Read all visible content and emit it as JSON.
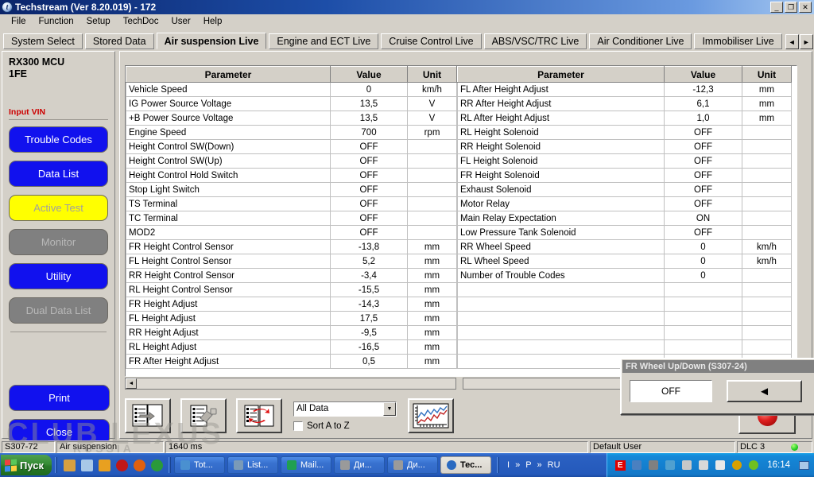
{
  "window": {
    "title": "Techstream (Ver 8.20.019) - 172",
    "icon": "techstream-logo-icon",
    "minimize": "_",
    "restore": "❐",
    "close": "✕"
  },
  "menubar": {
    "items": [
      "File",
      "Function",
      "Setup",
      "TechDoc",
      "User",
      "Help"
    ]
  },
  "tabs": {
    "items": [
      {
        "label": "System Select",
        "active": false
      },
      {
        "label": "Stored Data",
        "active": false
      },
      {
        "label": "Air suspension Live",
        "active": true
      },
      {
        "label": "Engine and ECT Live",
        "active": false
      },
      {
        "label": "Cruise Control Live",
        "active": false
      },
      {
        "label": "ABS/VSC/TRC Live",
        "active": false
      },
      {
        "label": "Air Conditioner Live",
        "active": false
      },
      {
        "label": "Immobiliser Live",
        "active": false
      }
    ],
    "prev_arrow": "◄",
    "next_arrow": "►"
  },
  "sidebar": {
    "mcu_line1": "RX300 MCU",
    "mcu_line2": "1FE",
    "input_vin": "Input VIN",
    "buttons": [
      {
        "label": "Trouble Codes",
        "style": "blue"
      },
      {
        "label": "Data List",
        "style": "blue"
      },
      {
        "label": "Active Test",
        "style": "yellow"
      },
      {
        "label": "Monitor",
        "style": "gray"
      },
      {
        "label": "Utility",
        "style": "blue"
      },
      {
        "label": "Dual Data List",
        "style": "gray"
      }
    ],
    "bottom_buttons": [
      {
        "label": "Print",
        "style": "blue"
      },
      {
        "label": "Close",
        "style": "blue"
      }
    ]
  },
  "table": {
    "headers": [
      "Parameter",
      "Value",
      "Unit"
    ],
    "left_rows": [
      {
        "parameter": "Vehicle Speed",
        "value": "0",
        "unit": "km/h"
      },
      {
        "parameter": "IG Power Source Voltage",
        "value": "13,5",
        "unit": "V"
      },
      {
        "parameter": "+B Power Source Voltage",
        "value": "13,5",
        "unit": "V"
      },
      {
        "parameter": "Engine Speed",
        "value": "700",
        "unit": "rpm"
      },
      {
        "parameter": "Height Control SW(Down)",
        "value": "OFF",
        "unit": ""
      },
      {
        "parameter": "Height Control SW(Up)",
        "value": "OFF",
        "unit": ""
      },
      {
        "parameter": "Height Control Hold Switch",
        "value": "OFF",
        "unit": ""
      },
      {
        "parameter": "Stop Light Switch",
        "value": "OFF",
        "unit": ""
      },
      {
        "parameter": "TS Terminal",
        "value": "OFF",
        "unit": ""
      },
      {
        "parameter": "TC Terminal",
        "value": "OFF",
        "unit": ""
      },
      {
        "parameter": "MOD2",
        "value": "OFF",
        "unit": ""
      },
      {
        "parameter": "FR Height Control Sensor",
        "value": "-13,8",
        "unit": "mm"
      },
      {
        "parameter": "FL Height Control Sensor",
        "value": "5,2",
        "unit": "mm"
      },
      {
        "parameter": "RR Height Control Sensor",
        "value": "-3,4",
        "unit": "mm"
      },
      {
        "parameter": "RL Height Control Sensor",
        "value": "-15,5",
        "unit": "mm"
      },
      {
        "parameter": "FR Height Adjust",
        "value": "-14,3",
        "unit": "mm"
      },
      {
        "parameter": "FL Height Adjust",
        "value": "17,5",
        "unit": "mm"
      },
      {
        "parameter": "RR Height Adjust",
        "value": "-9,5",
        "unit": "mm"
      },
      {
        "parameter": "RL Height Adjust",
        "value": "-16,5",
        "unit": "mm"
      },
      {
        "parameter": "FR After Height Adjust",
        "value": "0,5",
        "unit": "mm"
      }
    ],
    "right_rows": [
      {
        "parameter": "FL After Height Adjust",
        "value": "-12,3",
        "unit": "mm"
      },
      {
        "parameter": "RR After Height Adjust",
        "value": "6,1",
        "unit": "mm"
      },
      {
        "parameter": "RL After Height Adjust",
        "value": "1,0",
        "unit": "mm"
      },
      {
        "parameter": "RL Height Solenoid",
        "value": "OFF",
        "unit": ""
      },
      {
        "parameter": "RR Height Solenoid",
        "value": "OFF",
        "unit": ""
      },
      {
        "parameter": "FL Height Solenoid",
        "value": "OFF",
        "unit": ""
      },
      {
        "parameter": "FR Height Solenoid",
        "value": "OFF",
        "unit": ""
      },
      {
        "parameter": "Exhaust Solenoid",
        "value": "OFF",
        "unit": ""
      },
      {
        "parameter": "Motor Relay",
        "value": "OFF",
        "unit": ""
      },
      {
        "parameter": "Main Relay Expectation",
        "value": "ON",
        "unit": ""
      },
      {
        "parameter": "Low Pressure Tank Solenoid",
        "value": "OFF",
        "unit": ""
      },
      {
        "parameter": "RR Wheel Speed",
        "value": "0",
        "unit": "km/h"
      },
      {
        "parameter": "RL Wheel Speed",
        "value": "0",
        "unit": "km/h"
      },
      {
        "parameter": "Number of Trouble Codes",
        "value": "0",
        "unit": ""
      },
      {
        "parameter": "",
        "value": "",
        "unit": ""
      },
      {
        "parameter": "",
        "value": "",
        "unit": ""
      },
      {
        "parameter": "",
        "value": "",
        "unit": ""
      },
      {
        "parameter": "",
        "value": "",
        "unit": ""
      },
      {
        "parameter": "",
        "value": "",
        "unit": ""
      },
      {
        "parameter": "",
        "value": "",
        "unit": ""
      }
    ]
  },
  "dialog": {
    "title": "FR Wheel Up/Down (S307-24)",
    "close_label": "✕",
    "value": "OFF",
    "left_arrow": "◄",
    "right_arrow": "►"
  },
  "toolbar": {
    "buttons": [
      {
        "name": "select-data-icon",
        "tooltip": "Select Data"
      },
      {
        "name": "snapshot-icon",
        "tooltip": "Snapshot"
      },
      {
        "name": "refresh-data-icon",
        "tooltip": "Refresh"
      }
    ],
    "dropdown_value": "All Data",
    "dropdown_arrow": "▼",
    "sort_label": "Sort A to Z",
    "sort_checked": false,
    "graph_button": "graph-icon",
    "record_button": "record-icon"
  },
  "statusbar": {
    "code": "S307-72",
    "system": "Air suspension",
    "timing": "1640 ms",
    "user": "Default User",
    "dlc": "DLC 3"
  },
  "watermark": {
    "line1": "CLUB LEXUS",
    "line2": "RUSSIA"
  },
  "taskbar": {
    "start_label": "Пуск",
    "quick_launch": [
      {
        "name": "notepad-icon",
        "glyph": "📝"
      },
      {
        "name": "calculator-icon",
        "glyph": "🖩"
      },
      {
        "name": "checkmark-icon",
        "glyph": "✔"
      },
      {
        "name": "opera-icon",
        "glyph": "●"
      },
      {
        "name": "firefox-icon",
        "glyph": "●"
      },
      {
        "name": "chrome-icon",
        "glyph": "●"
      }
    ],
    "tasks": [
      {
        "label": "Tot...",
        "icon": "totalcmd-icon",
        "active": false
      },
      {
        "label": "List...",
        "icon": "lister-icon",
        "active": false
      },
      {
        "label": "Mail...",
        "icon": "mail-icon",
        "active": false
      },
      {
        "label": "Ди...",
        "icon": "explorer-icon",
        "active": false
      },
      {
        "label": "Ди...",
        "icon": "explorer-icon",
        "active": false
      },
      {
        "label": "Тес...",
        "icon": "techstream-logo-icon",
        "active": true
      }
    ],
    "ime": [
      "I",
      "»",
      "P",
      "»",
      "RU"
    ],
    "tray": [
      {
        "name": "eset-icon",
        "glyph": "E"
      },
      {
        "name": "network-icon",
        "glyph": "🖧"
      },
      {
        "name": "volume-muted-icon",
        "glyph": "🔇"
      },
      {
        "name": "update-icon",
        "glyph": "⟳"
      },
      {
        "name": "battery-icon",
        "glyph": "▯"
      },
      {
        "name": "volume-icon",
        "glyph": "🔈"
      },
      {
        "name": "flag-icon",
        "glyph": "⚑"
      },
      {
        "name": "target-icon",
        "glyph": "◎"
      },
      {
        "name": "frog-icon",
        "glyph": "●"
      }
    ],
    "clock": "16:14",
    "show_desktop": "🖥"
  }
}
